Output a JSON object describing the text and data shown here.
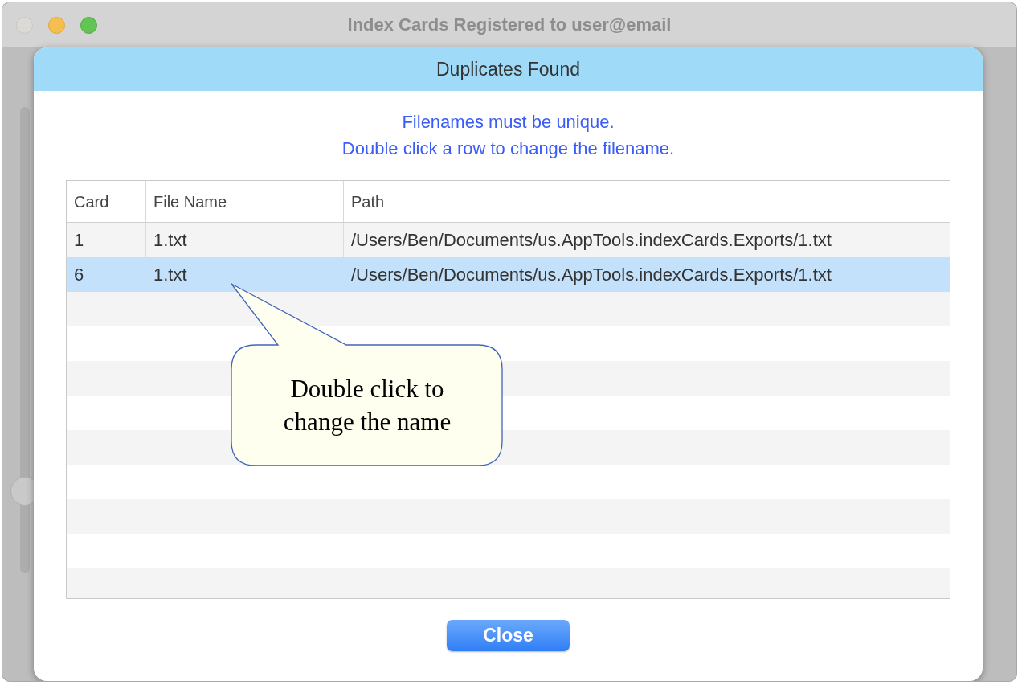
{
  "window": {
    "title": "Index Cards Registered to user@email"
  },
  "dialog": {
    "title": "Duplicates Found",
    "message": [
      "Filenames must be unique.",
      "Double click a row to change the filename."
    ]
  },
  "table": {
    "columns": [
      "Card",
      "File Name",
      "Path"
    ],
    "rows": [
      {
        "cells": [
          "1",
          "1.txt",
          "/Users/Ben/Documents/us.AppTools.indexCards.Exports/1.txt"
        ],
        "selected": false
      },
      {
        "cells": [
          "6",
          "1.txt",
          "/Users/Ben/Documents/us.AppTools.indexCards.Exports/1.txt"
        ],
        "selected": true
      }
    ]
  },
  "callout": {
    "text": "Double click to change the name"
  },
  "buttons": [
    {
      "label": "Close"
    }
  ]
}
